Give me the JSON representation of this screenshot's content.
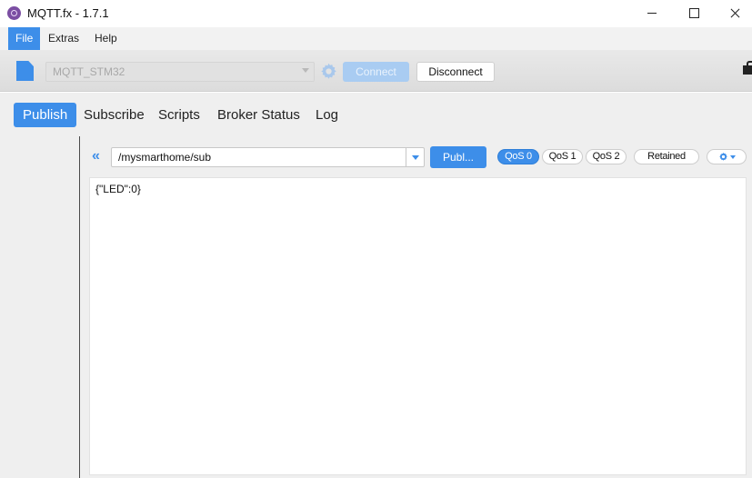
{
  "window": {
    "title": "MQTT.fx - 1.7.1",
    "icon": "mqttfx-app-icon"
  },
  "menu": {
    "items": [
      {
        "label": "File",
        "active": true
      },
      {
        "label": "Extras",
        "active": false
      },
      {
        "label": "Help",
        "active": false
      }
    ]
  },
  "connection": {
    "profile": "MQTT_STM32",
    "connect_label": "Connect",
    "disconnect_label": "Disconnect",
    "connected": true
  },
  "tabs": [
    {
      "label": "Publish",
      "active": true
    },
    {
      "label": "Subscribe",
      "active": false
    },
    {
      "label": "Scripts",
      "active": false
    },
    {
      "label": "Broker Status",
      "active": false
    },
    {
      "label": "Log",
      "active": false
    }
  ],
  "publish": {
    "topic": "/mysmarthome/sub",
    "publish_label": "Publ...",
    "qos": [
      {
        "label": "QoS 0",
        "selected": true
      },
      {
        "label": "QoS 1",
        "selected": false
      },
      {
        "label": "QoS 2",
        "selected": false
      }
    ],
    "retained_label": "Retained",
    "payload": "{\"LED\":0}"
  },
  "colors": {
    "accent": "#3d8ee9",
    "accent_disabled": "#a9ccf2",
    "panel_bg": "#efefef"
  }
}
